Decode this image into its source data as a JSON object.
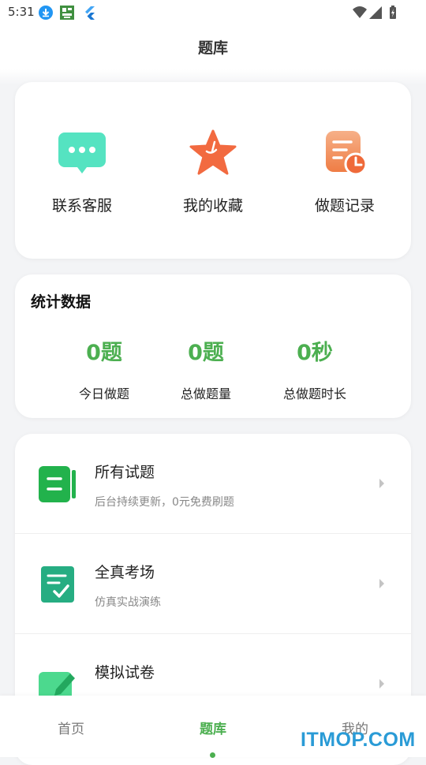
{
  "status_bar": {
    "time": "5:31",
    "left_icons": [
      "download-icon",
      "qr-app-icon",
      "flutter-icon"
    ],
    "right_icons": [
      "wifi-icon",
      "signal-icon",
      "battery-icon"
    ]
  },
  "header": {
    "title": "题库"
  },
  "quick_actions": [
    {
      "label": "联系客服",
      "icon": "chat-bubble-icon",
      "color": "#4fe0bd"
    },
    {
      "label": "我的收藏",
      "icon": "star-icon",
      "color": "#f26a40"
    },
    {
      "label": "做题记录",
      "icon": "record-clock-icon",
      "color": "#f08a52"
    }
  ],
  "stats": {
    "title": "统计数据",
    "items": [
      {
        "value": "0题",
        "caption": "今日做题"
      },
      {
        "value": "0题",
        "caption": "总做题量"
      },
      {
        "value": "0秒",
        "caption": "总做题时长"
      }
    ],
    "accent": "#4caf50"
  },
  "list": [
    {
      "title": "所有试题",
      "subtitle": "后台持续更新，0元免费刷题",
      "icon": "question-bank-icon"
    },
    {
      "title": "全真考场",
      "subtitle": "仿真实战演练",
      "icon": "exam-checklist-icon"
    },
    {
      "title": "模拟试卷",
      "subtitle": "",
      "icon": "pencil-paper-icon"
    }
  ],
  "bottom_nav": {
    "items": [
      {
        "label": "首页",
        "active": false
      },
      {
        "label": "题库",
        "active": true
      },
      {
        "label": "我的",
        "active": false
      }
    ]
  },
  "watermark": "ITMOP.COM"
}
